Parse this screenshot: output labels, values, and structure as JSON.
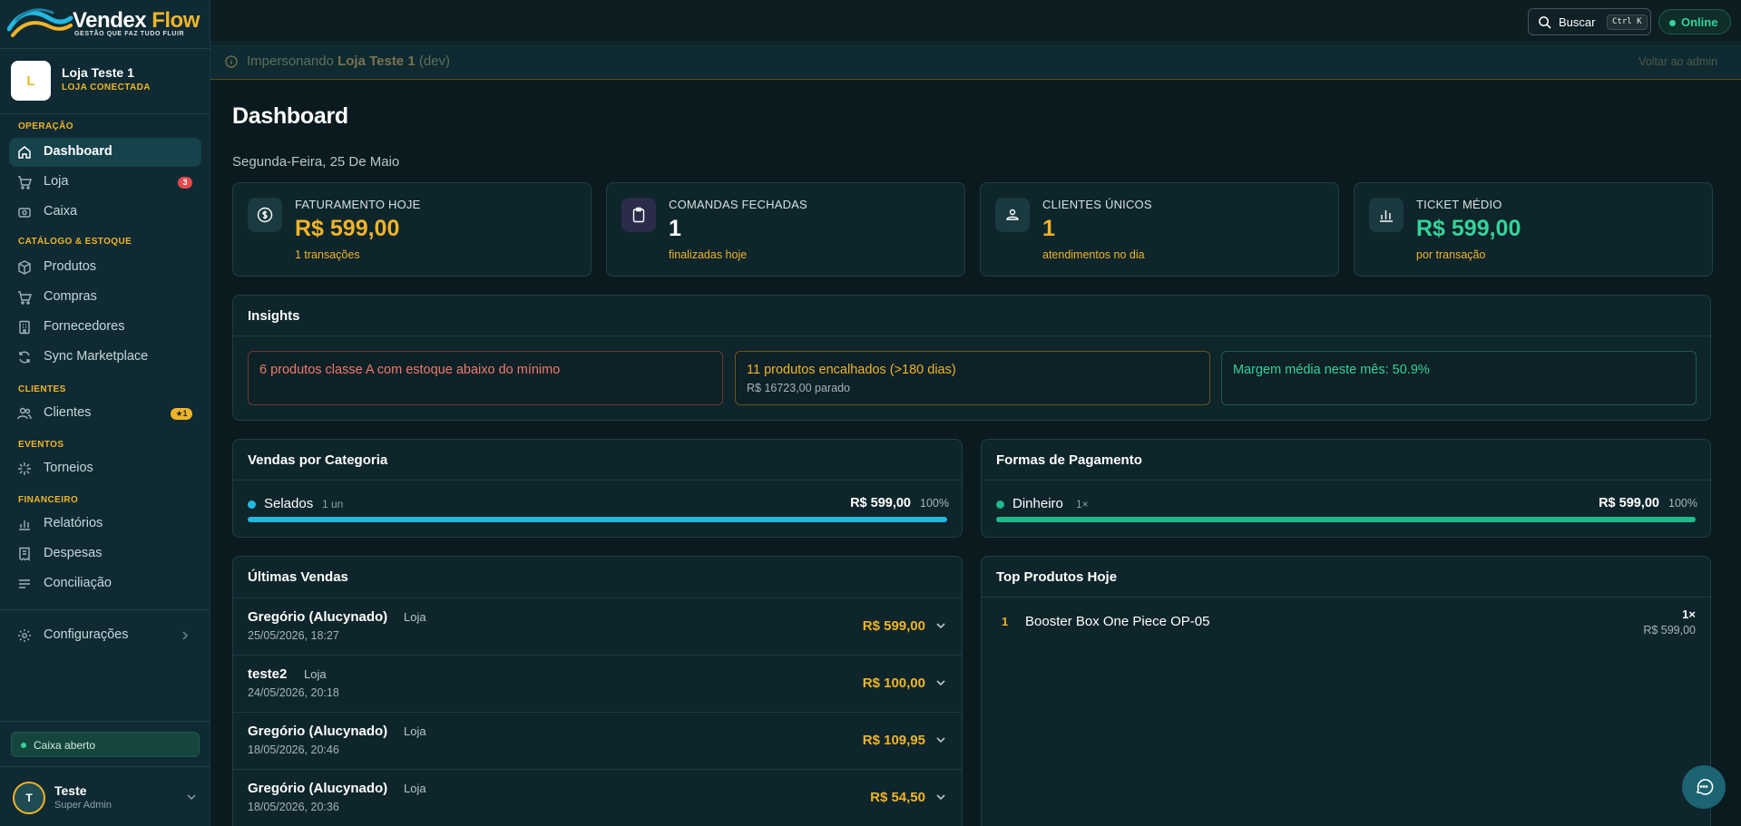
{
  "brand": {
    "name_part1": "Vendex",
    "name_part2": "Flow",
    "tagline": "GESTÃO QUE FAZ TUDO FLUIR"
  },
  "store": {
    "initial": "L",
    "name": "Loja Teste 1",
    "status": "LOJA CONECTADA"
  },
  "nav": {
    "sections": {
      "operacao": "OPERAÇÃO",
      "catalogo": "CATÁLOGO & ESTOQUE",
      "clientes": "CLIENTES",
      "eventos": "EVENTOS",
      "financeiro": "FINANCEIRO"
    },
    "items": {
      "dashboard": "Dashboard",
      "loja": "Loja",
      "loja_badge": "3",
      "caixa": "Caixa",
      "produtos": "Produtos",
      "compras": "Compras",
      "fornecedores": "Fornecedores",
      "sync": "Sync Marketplace",
      "clientes": "Clientes",
      "clientes_badge": "★1",
      "torneios": "Torneios",
      "relatorios": "Relatórios",
      "despesas": "Despesas",
      "conciliacao": "Conciliação",
      "configuracoes": "Configurações"
    }
  },
  "cash_status": "Caixa aberto",
  "user": {
    "initial": "T",
    "name": "Teste",
    "role": "Super Admin"
  },
  "topbar": {
    "search_label": "Buscar",
    "search_shortcut": "Ctrl K",
    "status": "Online"
  },
  "impersonation": {
    "prefix": "Impersonando",
    "store": "Loja Teste 1",
    "suffix": "(dev)",
    "back": "Voltar ao admin"
  },
  "page": {
    "title": "Dashboard",
    "date": "Segunda-Feira, 25 De Maio"
  },
  "kpis": [
    {
      "label": "FATURAMENTO HOJE",
      "value": "R$ 599,00",
      "sub": "1 transações",
      "icon": "dollar-circle-icon"
    },
    {
      "label": "COMANDAS FECHADAS",
      "value": "1",
      "sub": "finalizadas hoje",
      "icon": "clipboard-icon"
    },
    {
      "label": "CLIENTES ÚNICOS",
      "value": "1",
      "sub": "atendimentos no dia",
      "icon": "user-icon"
    },
    {
      "label": "TICKET MÉDIO",
      "value": "R$ 599,00",
      "sub": "por transação",
      "icon": "bar-chart-icon"
    }
  ],
  "insights": {
    "title": "Insights",
    "items": [
      {
        "text": "6 produtos classe A com estoque abaixo do mínimo",
        "sub": "",
        "color": "#f07a6a"
      },
      {
        "text": "11 produtos encalhados (>180 dias)",
        "sub": "R$ 16723,00 parado",
        "color": "#f0b429"
      },
      {
        "text": "Margem média neste mês: 50.9%",
        "sub": "",
        "color": "#34d399"
      }
    ]
  },
  "sales_by_category": {
    "title": "Vendas por Categoria",
    "rows": [
      {
        "name": "Selados",
        "qty": "1 un",
        "value": "R$ 599,00",
        "pct": "100%",
        "share": 1.0,
        "color": "#22b8e0"
      }
    ]
  },
  "payment_methods": {
    "title": "Formas de Pagamento",
    "rows": [
      {
        "name": "Dinheiro",
        "qty": "1×",
        "value": "R$ 599,00",
        "pct": "100%",
        "share": 1.0,
        "color": "#1fb889"
      }
    ]
  },
  "recent_sales": {
    "title": "Últimas Vendas",
    "rows": [
      {
        "customer": "Gregório (Alucynado)",
        "source": "Loja",
        "datetime": "25/05/2026, 18:27",
        "amount": "R$ 599,00"
      },
      {
        "customer": "teste2",
        "source": "Loja",
        "datetime": "24/05/2026, 20:18",
        "amount": "R$ 100,00"
      },
      {
        "customer": "Gregório (Alucynado)",
        "source": "Loja",
        "datetime": "18/05/2026, 20:46",
        "amount": "R$ 109,95"
      },
      {
        "customer": "Gregório (Alucynado)",
        "source": "Loja",
        "datetime": "18/05/2026, 20:36",
        "amount": "R$ 54,50"
      }
    ]
  },
  "top_products": {
    "title": "Top Produtos Hoje",
    "rows": [
      {
        "rank": "1",
        "name": "Booster Box One Piece OP-05",
        "qty": "1×",
        "value": "R$ 599,00"
      }
    ]
  },
  "colors": {
    "accent": "#f0b429",
    "success": "#34d399",
    "danger": "#e5484d",
    "background": "#0b1a1f",
    "sidebar": "#0f2a33"
  }
}
